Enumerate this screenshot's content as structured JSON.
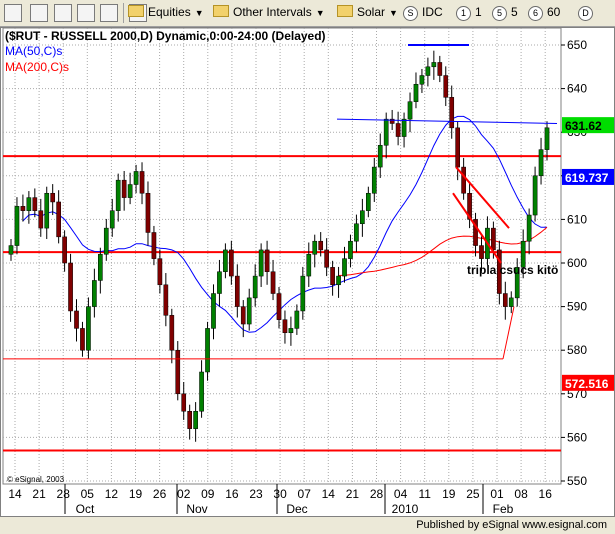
{
  "toolbar": {
    "menus": [
      {
        "label": "Equities",
        "icon": "folder-icon"
      },
      {
        "label": "Other Intervals",
        "icon": "folder-icon"
      },
      {
        "label": "Solar",
        "icon": "folder-icon"
      }
    ],
    "intervals": [
      {
        "symbol": "S",
        "label": "IDC"
      },
      {
        "symbol": "1",
        "label": "1"
      },
      {
        "symbol": "5",
        "label": "5"
      },
      {
        "symbol": "6",
        "label": "60"
      },
      {
        "symbol": "D",
        "label": ""
      }
    ]
  },
  "colors": {
    "price_line": "#ff0000",
    "ma50": "#0000ff",
    "ma200": "#ff0000",
    "candle_up": "#008000",
    "candle_down": "#800000",
    "grid": "#aaaaaa"
  },
  "status_bar": {
    "text": "Published by eSignal www.esignal.com"
  },
  "chart_data": {
    "type": "candlestick",
    "title": "($RUT - RUSSELL 2000,D) Dynamic,0:00-24:00 (Delayed)",
    "indicators": [
      {
        "name": "MA(50,C)s",
        "color": "#0000ff"
      },
      {
        "name": "MA(200,C)s",
        "color": "#ff0000"
      }
    ],
    "ylim": [
      548,
      654
    ],
    "y_ticks": [
      550,
      560,
      570,
      580,
      590,
      600,
      610,
      620,
      630,
      640,
      650
    ],
    "x_tick_labels": [
      "14",
      "21",
      "28",
      "05",
      "12",
      "19",
      "26",
      "02",
      "09",
      "16",
      "23",
      "30",
      "07",
      "14",
      "21",
      "28",
      "04",
      "11",
      "19",
      "25",
      "01",
      "08",
      "16"
    ],
    "month_labels": [
      "Oct",
      "Nov",
      "Dec",
      "2010",
      "Feb"
    ],
    "price_tags": [
      {
        "label": "631.62",
        "value": 631.62,
        "bg": "#00dd00",
        "fg": "#000000"
      },
      {
        "label": "619.737",
        "value": 619.737,
        "bg": "#0000ff",
        "fg": "#ffffff"
      },
      {
        "label": "572.516",
        "value": 572.516,
        "bg": "#ff0000",
        "fg": "#ffffff"
      }
    ],
    "horizontal_levels": [
      {
        "value": 624.5,
        "color": "#ff0000"
      },
      {
        "value": 602.5,
        "color": "#ff0000"
      },
      {
        "value": 557,
        "color": "#ff0000"
      }
    ],
    "annotation": "tripla csucs kitö",
    "watermark": "© eSignal, 2003",
    "close": [
      604,
      613,
      612,
      615,
      612,
      608,
      616,
      614,
      606,
      600,
      589,
      585,
      580,
      590,
      596,
      602,
      608,
      612,
      619,
      615,
      618,
      621,
      616,
      607,
      601,
      595,
      588,
      580,
      570,
      566,
      562,
      566,
      575,
      585,
      593,
      598,
      603,
      597,
      590,
      586,
      592,
      597,
      603,
      598,
      593,
      587,
      584,
      585,
      589,
      597,
      602,
      605,
      603,
      599,
      595,
      597,
      601,
      605,
      609,
      612,
      616,
      622,
      627,
      633,
      632,
      629,
      633,
      637,
      641,
      643,
      645,
      646,
      643,
      638,
      631,
      622,
      616,
      610,
      604,
      601,
      608,
      603,
      593,
      590,
      592,
      599,
      605,
      611,
      620,
      626,
      631
    ]
  }
}
